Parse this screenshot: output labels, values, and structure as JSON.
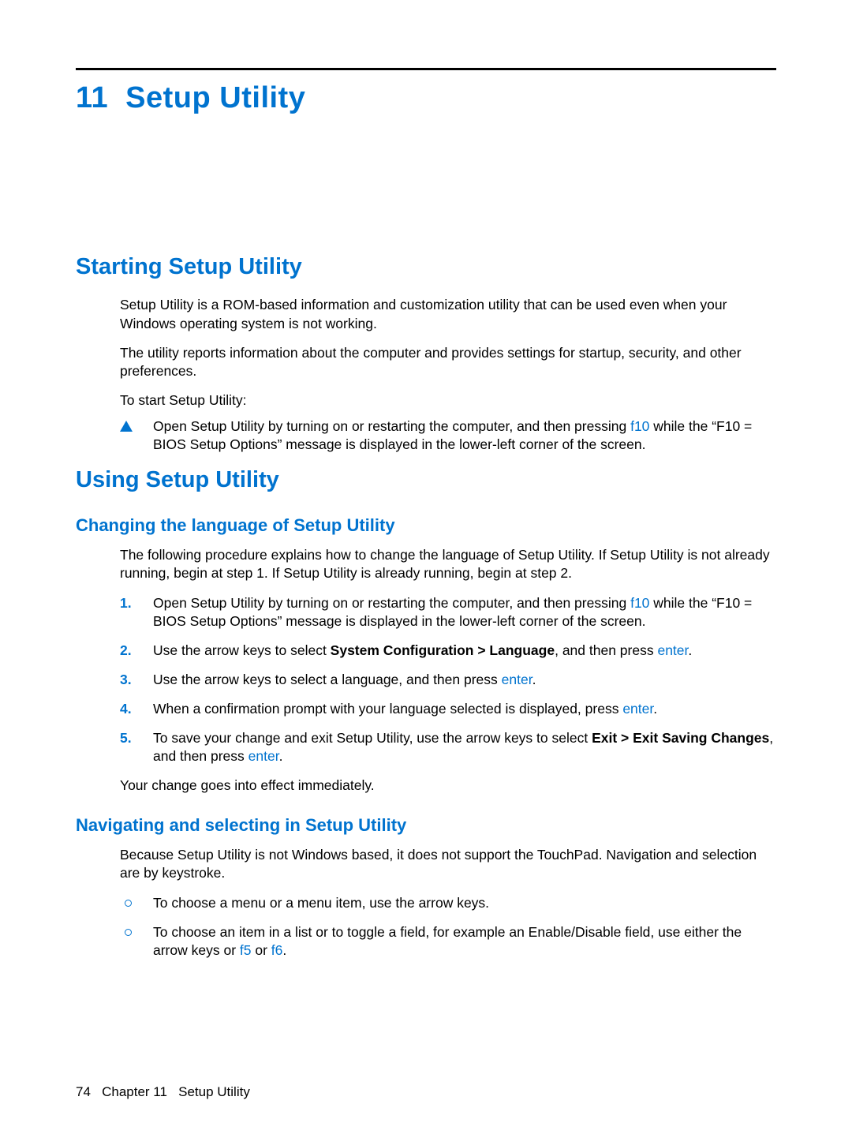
{
  "chapter": {
    "number": "11",
    "title": "Setup Utility"
  },
  "sec_starting": {
    "heading": "Starting Setup Utility",
    "p1": "Setup Utility is a ROM-based information and customization utility that can be used even when your Windows operating system is not working.",
    "p2": "The utility reports information about the computer and provides settings for startup, security, and other preferences.",
    "p3": "To start Setup Utility:",
    "bullet1_a": "Open Setup Utility by turning on or restarting the computer, and then pressing ",
    "bullet1_key": "f10",
    "bullet1_b": " while the “F10 = BIOS Setup Options” message is displayed in the lower-left corner of the screen."
  },
  "sec_using": {
    "heading": "Using Setup Utility",
    "sub_lang": {
      "heading": "Changing the language of Setup Utility",
      "p1": "The following procedure explains how to change the language of Setup Utility. If Setup Utility is not already running, begin at step 1. If Setup Utility is already running, begin at step 2.",
      "steps": {
        "s1_a": "Open Setup Utility by turning on or restarting the computer, and then pressing ",
        "s1_key": "f10",
        "s1_b": " while the “F10 = BIOS Setup Options” message is displayed in the lower-left corner of the screen.",
        "s2_a": "Use the arrow keys to select ",
        "s2_bold": "System Configuration > Language",
        "s2_b": ", and then press ",
        "s2_key": "enter",
        "s2_c": ".",
        "s3_a": "Use the arrow keys to select a language, and then press ",
        "s3_key": "enter",
        "s3_b": ".",
        "s4_a": "When a confirmation prompt with your language selected is displayed, press ",
        "s4_key": "enter",
        "s4_b": ".",
        "s5_a": "To save your change and exit Setup Utility, use the arrow keys to select ",
        "s5_bold": "Exit > Exit Saving Changes",
        "s5_b": ", and then press ",
        "s5_key": "enter",
        "s5_c": "."
      },
      "p_after": "Your change goes into effect immediately."
    },
    "sub_nav": {
      "heading": "Navigating and selecting in Setup Utility",
      "p1": "Because Setup Utility is not Windows based, it does not support the TouchPad. Navigation and selection are by keystroke.",
      "b1": "To choose a menu or a menu item, use the arrow keys.",
      "b2_a": "To choose an item in a list or to toggle a field, for example an Enable/Disable field, use either the arrow keys or ",
      "b2_key1": "f5",
      "b2_mid": " or ",
      "b2_key2": "f6",
      "b2_b": "."
    }
  },
  "footer": {
    "page": "74",
    "label_a": "Chapter 11",
    "label_b": "Setup Utility"
  },
  "nums": {
    "n1": "1.",
    "n2": "2.",
    "n3": "3.",
    "n4": "4.",
    "n5": "5."
  }
}
